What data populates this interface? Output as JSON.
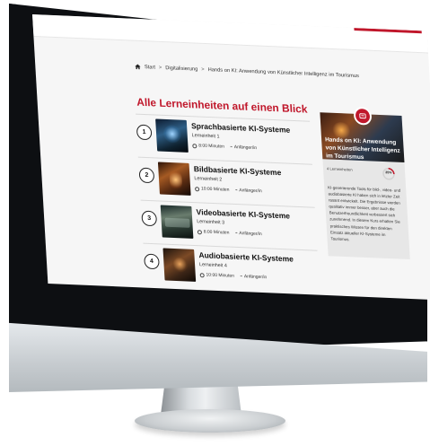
{
  "breadcrumb": {
    "items": [
      "Start",
      "Digitalisierung",
      "Hands on KI: Anwendung von Künstlicher Intelligenz im Tourismus"
    ],
    "separator": ">"
  },
  "page_title": "Alle Lerneinheiten auf einen Blick",
  "lessons": [
    {
      "number": "1",
      "title": "Sprachbasierte KI-Systeme",
      "unit": "Lerneinheit 1",
      "duration": "8:00 Minuten",
      "level": "Anfänger/in"
    },
    {
      "number": "2",
      "title": "Bildbasierte KI-Systeme",
      "unit": "Lerneinheit 2",
      "duration": "10:00 Minuten",
      "level": "Anfänger/in"
    },
    {
      "number": "3",
      "title": "Videobasierte KI-Systeme",
      "unit": "Lerneinheit 3",
      "duration": "8:00 Minuten",
      "level": "Anfänger/in"
    },
    {
      "number": "4",
      "title": "Audiobasierte KI-Systeme",
      "unit": "Lerneinheit 4",
      "duration": "10:00 Minuten",
      "level": "Anfänger/in"
    }
  ],
  "course_card": {
    "title": "Hands on KI: Anwendung von Künstlicher Intelligenz im Tourismus",
    "lesson_count": "4 Lerneinheiten",
    "progress_percent": 25,
    "progress_label": "25%",
    "description": "KI-generierende Tools für bild-, video- und audiobasierte KI haben sich in letzter Zeit rasant entwickelt. Die Ergebnisse werden qualitativ immer besser, aber auch die Benutzerfreundlichkeit verbessert sich zunehmend. In diesem Kurs erhalten Sie praktisches Wissen für den direkten Einsatz aktueller KI-Systeme im Tourismus."
  },
  "colors": {
    "accent": "#c0172b",
    "screen_bg": "#f6f6f6",
    "card_bg": "#e7e7e7"
  },
  "icons": [
    "home-icon",
    "clock-icon",
    "level-icon",
    "course-badge-icon"
  ]
}
